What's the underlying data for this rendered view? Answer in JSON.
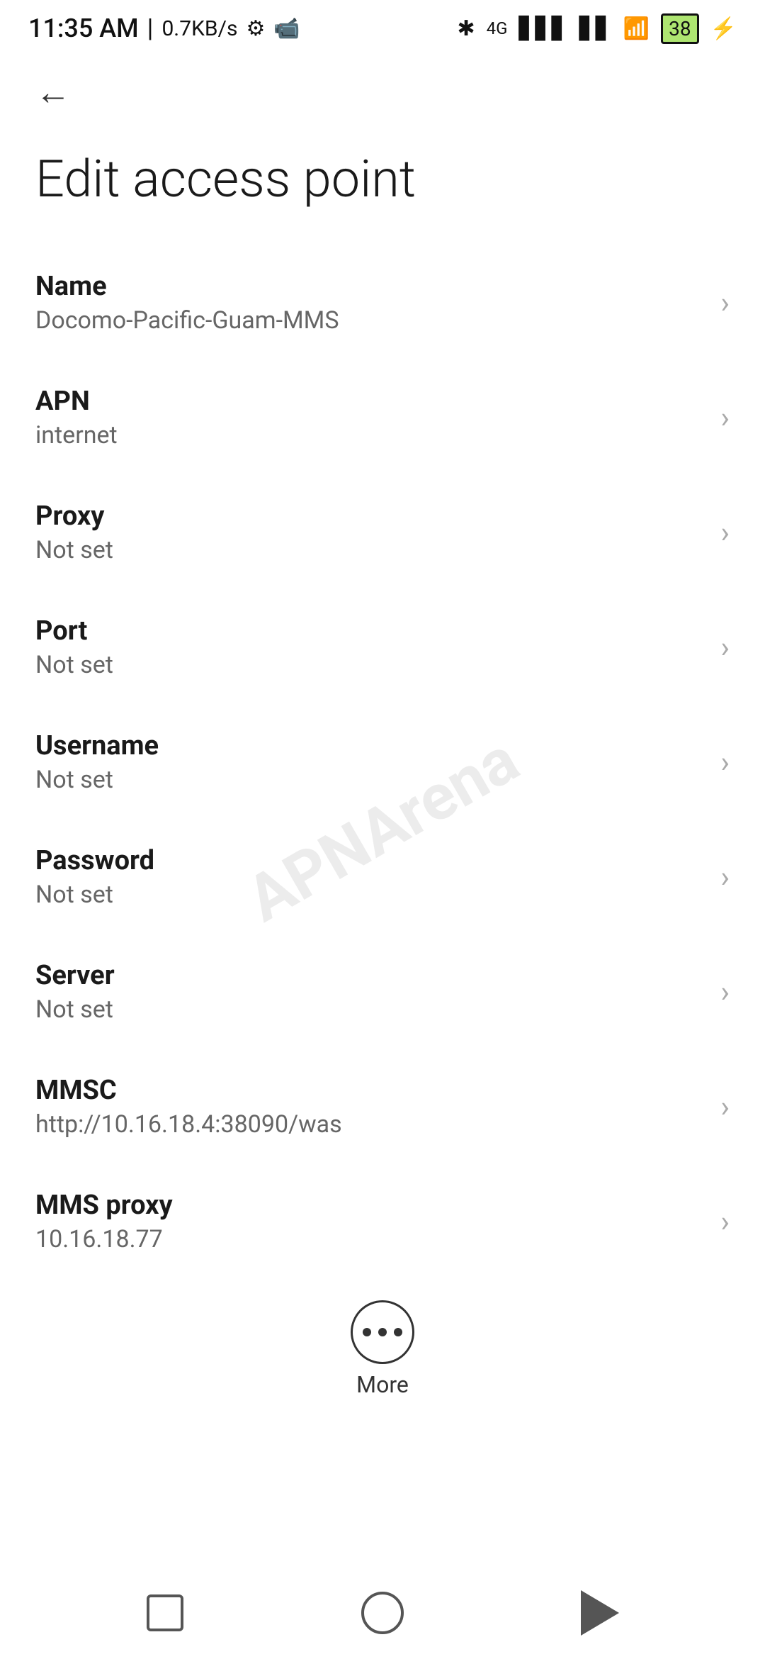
{
  "statusBar": {
    "time": "11:35 AM",
    "separator": "|",
    "speed": "0.7KB/s"
  },
  "toolbar": {
    "back_label": "←"
  },
  "page": {
    "title": "Edit access point"
  },
  "settings": {
    "items": [
      {
        "label": "Name",
        "value": "Docomo-Pacific-Guam-MMS"
      },
      {
        "label": "APN",
        "value": "internet"
      },
      {
        "label": "Proxy",
        "value": "Not set"
      },
      {
        "label": "Port",
        "value": "Not set"
      },
      {
        "label": "Username",
        "value": "Not set"
      },
      {
        "label": "Password",
        "value": "Not set"
      },
      {
        "label": "Server",
        "value": "Not set"
      },
      {
        "label": "MMSC",
        "value": "http://10.16.18.4:38090/was"
      },
      {
        "label": "MMS proxy",
        "value": "10.16.18.77"
      }
    ]
  },
  "more": {
    "label": "More"
  },
  "watermark": {
    "text": "APNArena"
  }
}
